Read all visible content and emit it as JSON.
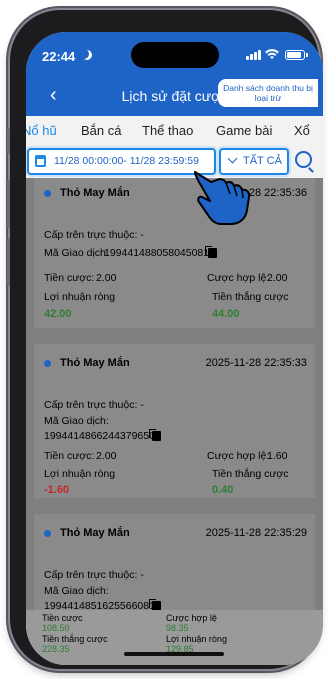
{
  "status_bar": {
    "time": "22:44"
  },
  "header": {
    "title": "Lịch sử đặt cược",
    "side_link": "Danh sách doanh thu bị loại trừ"
  },
  "tabs": [
    {
      "label": "Nổ hũ",
      "active": true
    },
    {
      "label": "Bắn cá",
      "active": false
    },
    {
      "label": "Thể thao",
      "active": false
    },
    {
      "label": "Game bài",
      "active": false
    },
    {
      "label": "Xổ",
      "active": false
    }
  ],
  "filter": {
    "date_range": "11/28 00:00:00- 11/28 23:59:59",
    "type_select": "TẤT CẢ"
  },
  "labels": {
    "parent": "Cấp trên trực thuộc: -",
    "tx": "Mã Giao dịch:",
    "bet": "Tiền cược:",
    "valid": "Cược hợp lệ:",
    "profit": "Lợi nhuận ròng",
    "win": "Tiền thắng cược"
  },
  "records": [
    {
      "game": "Thỏ May Mắn",
      "timestamp": "2025-11-28 22:35:36",
      "tx_id": "1994414880580450817",
      "bet": "2.00",
      "valid_bet": "2.00",
      "net_profit": "42.00",
      "win": "44.00"
    },
    {
      "game": "Thỏ May Mắn",
      "timestamp": "2025-11-28 22:35:33",
      "tx_id": "1994414866244379650",
      "bet": "2.00",
      "valid_bet": "1.60",
      "net_profit": "-1.60",
      "win": "0.40"
    },
    {
      "game": "Thỏ May Mắn",
      "timestamp": "2025-11-28 22:35:29",
      "tx_id": "1994414851625566081",
      "bet": "",
      "valid_bet": "",
      "net_profit": "",
      "win": ""
    }
  ],
  "summary": {
    "bet_label": "Tiền cược",
    "bet_value": "108.50",
    "valid_label": "Cược hợp lệ",
    "valid_value": "98.35",
    "win_label": "Tiền thắng cược",
    "win_value": "228.35",
    "profit_label": "Lợi nhuận ròng",
    "profit_value": "129.85"
  },
  "colors": {
    "brand": "#1e63c6",
    "accent": "#1e88e5",
    "profit_positive": "#2e7d32",
    "profit_negative": "#c62828"
  }
}
